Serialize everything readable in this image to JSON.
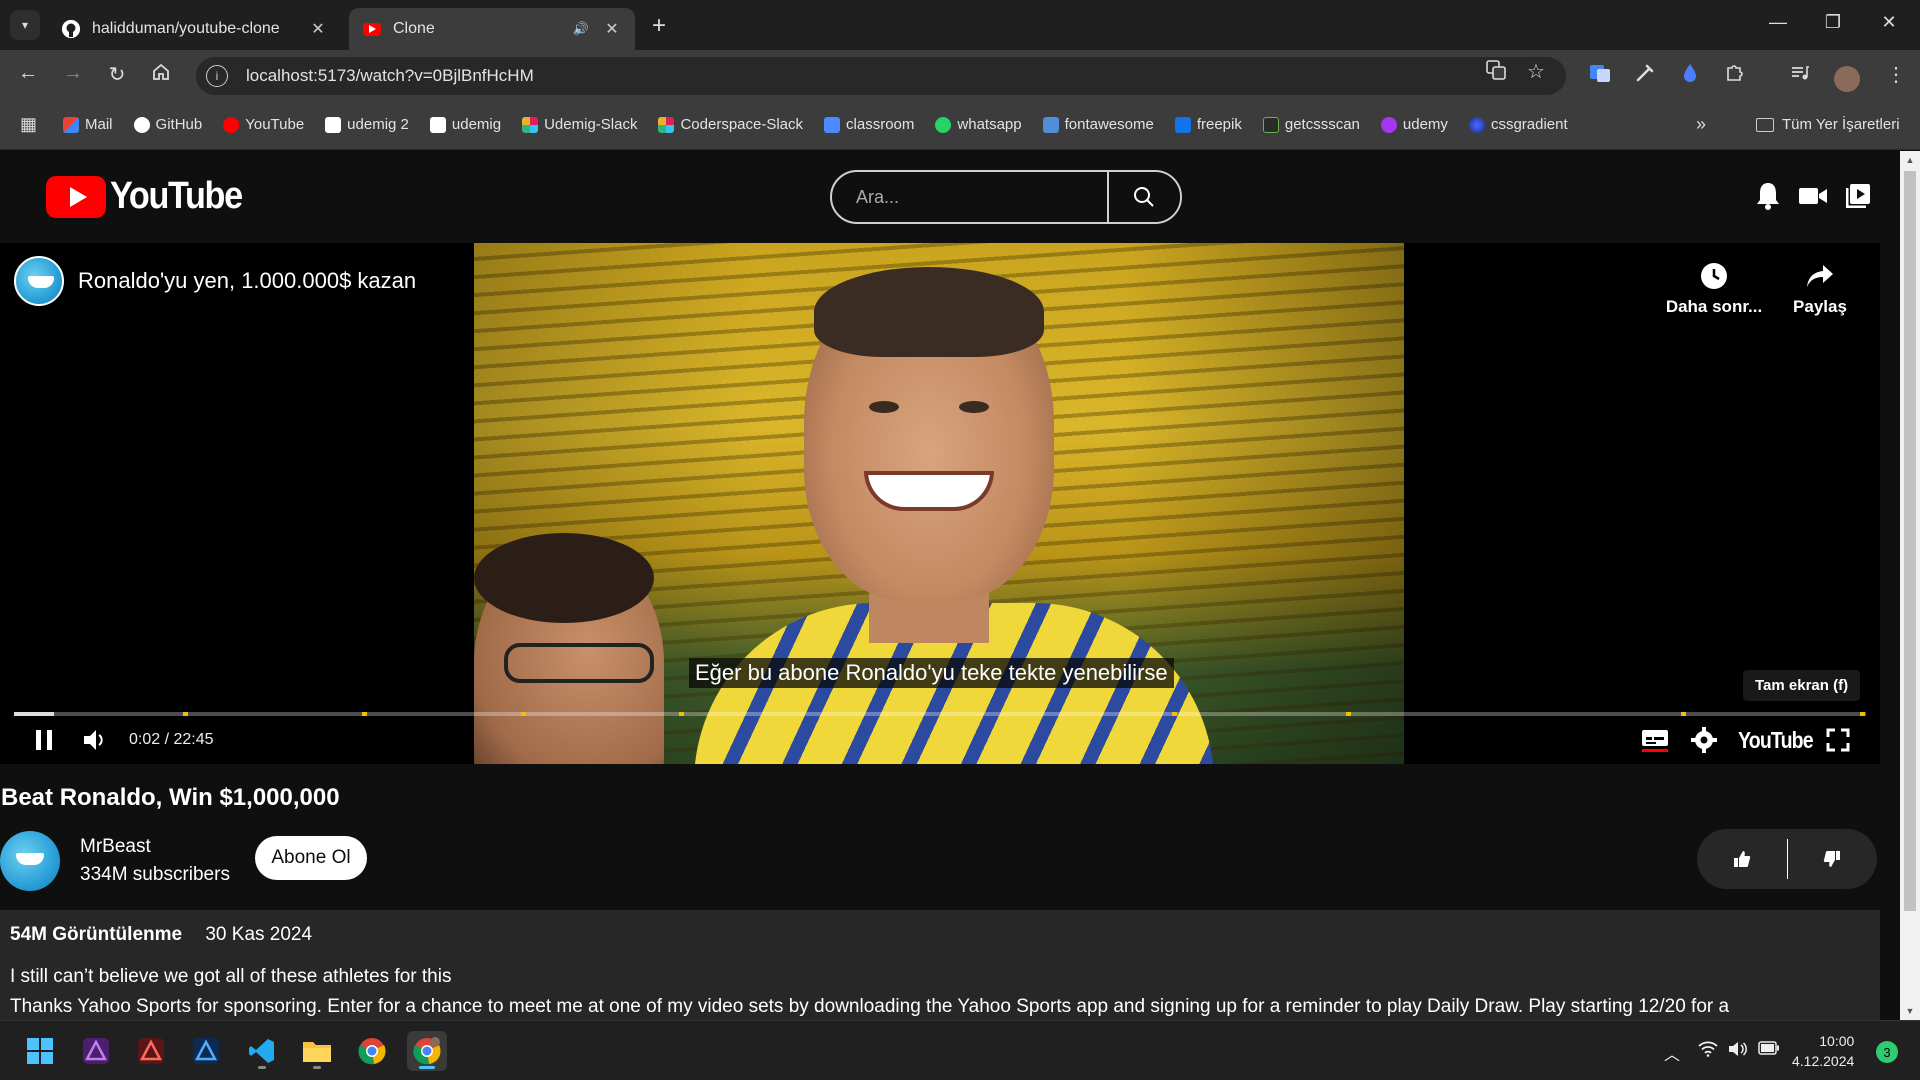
{
  "browser": {
    "tabs": [
      {
        "title": "halidduman/youtube-clone",
        "favicon": "github-icon",
        "active": false
      },
      {
        "title": "Clone",
        "favicon": "youtube-icon",
        "active": true
      }
    ],
    "url": "localhost:5173/watch?v=0BjlBnfHcHM",
    "bookmarks": [
      {
        "label": "Mail",
        "icon": "gmail-icon",
        "color": "#ea4335"
      },
      {
        "label": "GitHub",
        "icon": "github-icon",
        "color": "#ffffff"
      },
      {
        "label": "YouTube",
        "icon": "youtube-icon",
        "color": "#ff0000"
      },
      {
        "label": "udemig 2",
        "icon": "udemig-icon",
        "color": "#8a9cff"
      },
      {
        "label": "udemig",
        "icon": "udemig-icon",
        "color": "#8a9cff"
      },
      {
        "label": "Udemig-Slack",
        "icon": "slack-icon",
        "color": "#e01e5a"
      },
      {
        "label": "Coderspace-Slack",
        "icon": "slack-icon",
        "color": "#36c5f0"
      },
      {
        "label": "classroom",
        "icon": "classroom-icon",
        "color": "#4a8cff"
      },
      {
        "label": "whatsapp",
        "icon": "whatsapp-icon",
        "color": "#25d366"
      },
      {
        "label": "fontawesome",
        "icon": "fontawesome-icon",
        "color": "#528dd7"
      },
      {
        "label": "freepik",
        "icon": "freepik-icon",
        "color": "#1273eb"
      },
      {
        "label": "getcssscan",
        "icon": "getcssscan-icon",
        "color": "#6ab04c"
      },
      {
        "label": "udemy",
        "icon": "udemy-icon",
        "color": "#a435f0"
      },
      {
        "label": "cssgradient",
        "icon": "cssgradient-icon",
        "color": "#3b5bdb"
      }
    ],
    "all_bookmarks": "Tüm Yer İşaretleri"
  },
  "header": {
    "logo_text": "YouTube",
    "search_placeholder": "Ara..."
  },
  "player": {
    "overlay_title": "Ronaldo'yu yen, 1.000.000$ kazan",
    "watch_later": "Daha sonr...",
    "share": "Paylaş",
    "caption": "Eğer bu abone Ronaldo'yu teke tekte yenebilirse",
    "fullscreen_tooltip": "Tam ekran (f)",
    "time": "0:02 / 22:45",
    "progress": 0.0015,
    "brand": "YouTube"
  },
  "video": {
    "title": "Beat Ronaldo, Win $1,000,000",
    "channel": "MrBeast",
    "subscribers": "334M subscribers",
    "subscribe_label": "Abone Ol",
    "views": "54M Görüntülenme",
    "date": "30 Kas 2024",
    "description_line1": "I still can’t believe we got all of these athletes for this",
    "description_line2": "Thanks Yahoo Sports for sponsoring. Enter for a chance to meet me at one of my video sets by downloading the Yahoo Sports app and signing up for a reminder to play Daily Draw. Play starting 12/20 for a"
  },
  "taskbar": {
    "time": "10:00",
    "date": "4.12.2024",
    "notifications": "3"
  },
  "colors": {
    "brand_red": "#ff0000",
    "page_bg": "#0f0f0f",
    "panel_bg": "#272727"
  }
}
